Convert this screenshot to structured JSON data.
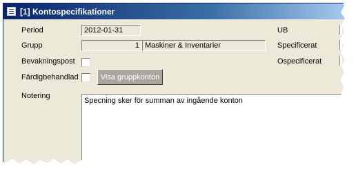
{
  "window": {
    "title": "[1] Kontospecifikationer"
  },
  "form": {
    "period_label": "Period",
    "period_value": "2012-01-31",
    "grupp_label": "Grupp",
    "grupp_number": "1",
    "grupp_name": "Maskiner & Inventarier",
    "bevakningspost_label": "Bevakningspost",
    "fardigbehandlad_label": "Färdigbehandlad",
    "visa_button_label": "Visa gruppkonton",
    "notering_label": "Notering",
    "notering_text": "Specning sker för summan av ingående konton"
  },
  "right": {
    "ub_label": "UB",
    "specificerat_label": "Specificerat",
    "ospecificerat_label": "Ospecificerat"
  }
}
